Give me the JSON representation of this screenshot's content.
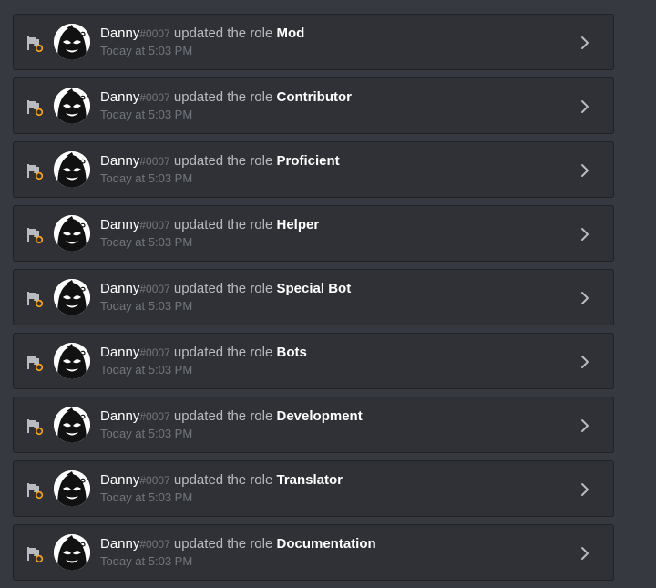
{
  "audit_log": {
    "entries": [
      {
        "user": "Danny",
        "discriminator": "#0007",
        "action": "updated the role",
        "target": "Mod",
        "timestamp": "Today at 5:03 PM"
      },
      {
        "user": "Danny",
        "discriminator": "#0007",
        "action": "updated the role",
        "target": "Contributor",
        "timestamp": "Today at 5:03 PM"
      },
      {
        "user": "Danny",
        "discriminator": "#0007",
        "action": "updated the role",
        "target": "Proficient",
        "timestamp": "Today at 5:03 PM"
      },
      {
        "user": "Danny",
        "discriminator": "#0007",
        "action": "updated the role",
        "target": "Helper",
        "timestamp": "Today at 5:03 PM"
      },
      {
        "user": "Danny",
        "discriminator": "#0007",
        "action": "updated the role",
        "target": "Special Bot",
        "timestamp": "Today at 5:03 PM"
      },
      {
        "user": "Danny",
        "discriminator": "#0007",
        "action": "updated the role",
        "target": "Bots",
        "timestamp": "Today at 5:03 PM"
      },
      {
        "user": "Danny",
        "discriminator": "#0007",
        "action": "updated the role",
        "target": "Development",
        "timestamp": "Today at 5:03 PM"
      },
      {
        "user": "Danny",
        "discriminator": "#0007",
        "action": "updated the role",
        "target": "Translator",
        "timestamp": "Today at 5:03 PM"
      },
      {
        "user": "Danny",
        "discriminator": "#0007",
        "action": "updated the role",
        "target": "Documentation",
        "timestamp": "Today at 5:03 PM"
      }
    ]
  },
  "icons": {
    "entry_icon": "role-flag-update-icon",
    "avatar": "avatar-image",
    "expand": "chevron-right-icon"
  },
  "colors": {
    "background": "#36393f",
    "card": "#2f3136",
    "username": "#ffffff",
    "discriminator": "#72767d",
    "action_text": "#b9bbbe",
    "timestamp": "#72767d",
    "update_accent": "#faa61a"
  }
}
